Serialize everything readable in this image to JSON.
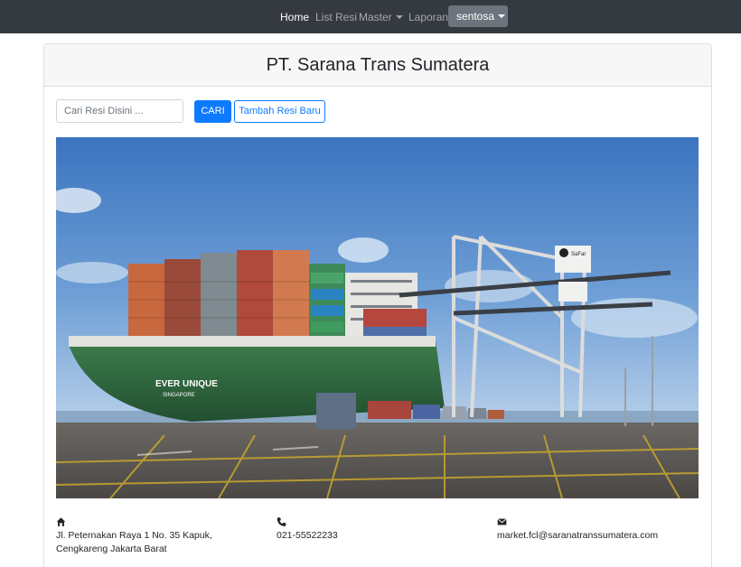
{
  "navbar": {
    "home": "Home",
    "list_resi": "List Resi",
    "master": "Master",
    "laporan": "Laporan",
    "user": "sentosa"
  },
  "header": {
    "title": "PT. Sarana Trans Sumatera"
  },
  "search": {
    "placeholder": "Cari Resi Disini ...",
    "value": "",
    "button": "CARI",
    "add_button": "Tambah Resi Baru"
  },
  "hero": {
    "ship_name": "EVER UNIQUE",
    "ship_port": "SINGAPORE",
    "crane_brand": "SaFar",
    "container_brand": "EVERGREEN"
  },
  "contact": {
    "address_line1": "Jl. Peternakan Raya 1 No. 35 Kapuk,",
    "address_line2": "Cengkareng Jakarta Barat",
    "phone": "021-55522233",
    "email": "market.fcl@saranatranssumatera.com",
    "address_icon": "home-icon",
    "phone_icon": "phone-icon",
    "email_icon": "envelope-icon"
  },
  "colors": {
    "navbar": "#343a40",
    "primary": "#0d7bff",
    "hull": "#2f6b3f",
    "sky": "#4f86c8"
  }
}
